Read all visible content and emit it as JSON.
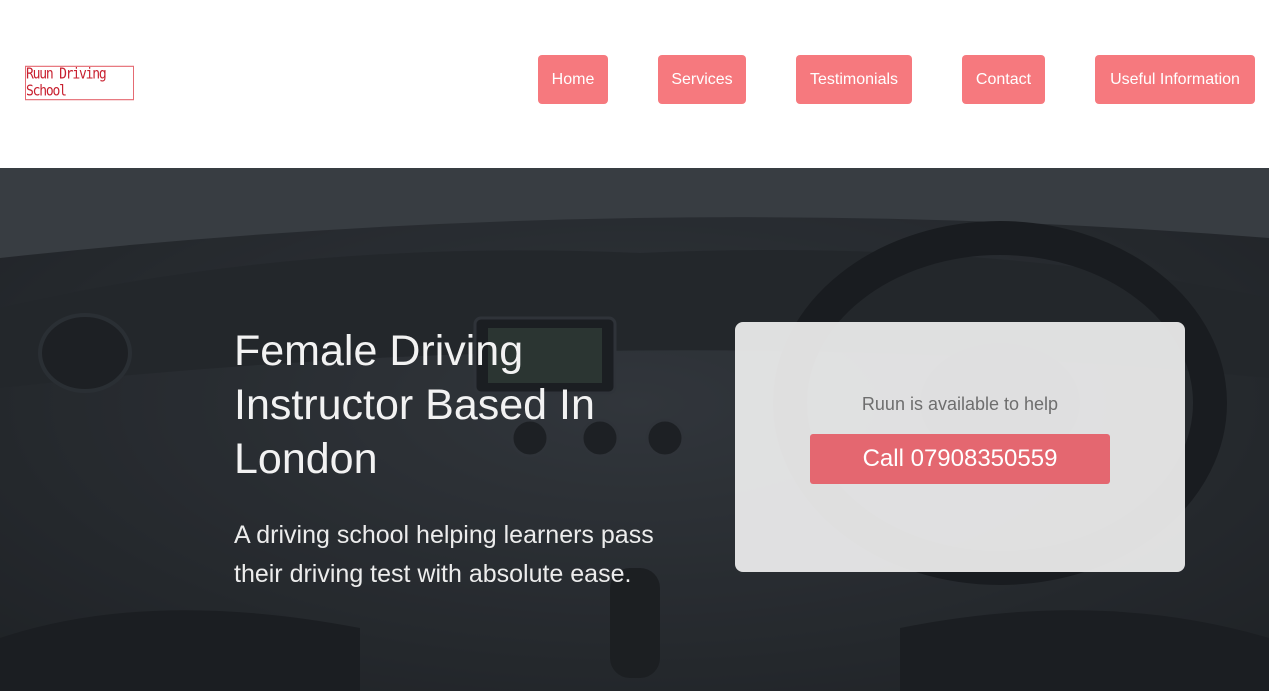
{
  "logo": {
    "text": "Ruun Driving School"
  },
  "nav": {
    "items": [
      {
        "label": "Home"
      },
      {
        "label": "Services"
      },
      {
        "label": "Testimonials"
      },
      {
        "label": "Contact"
      },
      {
        "label": "Useful Information"
      }
    ]
  },
  "hero": {
    "headline": "Female Driving Instructor Based In London",
    "subtext": "A driving school helping learners pass their driving test with absolute ease."
  },
  "cta": {
    "text": "Ruun is available to help",
    "button_label": "Call 07908350559"
  },
  "colors": {
    "nav_button": "#f6797e",
    "call_button": "#e46770",
    "logo_accent": "#c8202f"
  },
  "icons": {
    "hero_image": "car-interior-image"
  }
}
